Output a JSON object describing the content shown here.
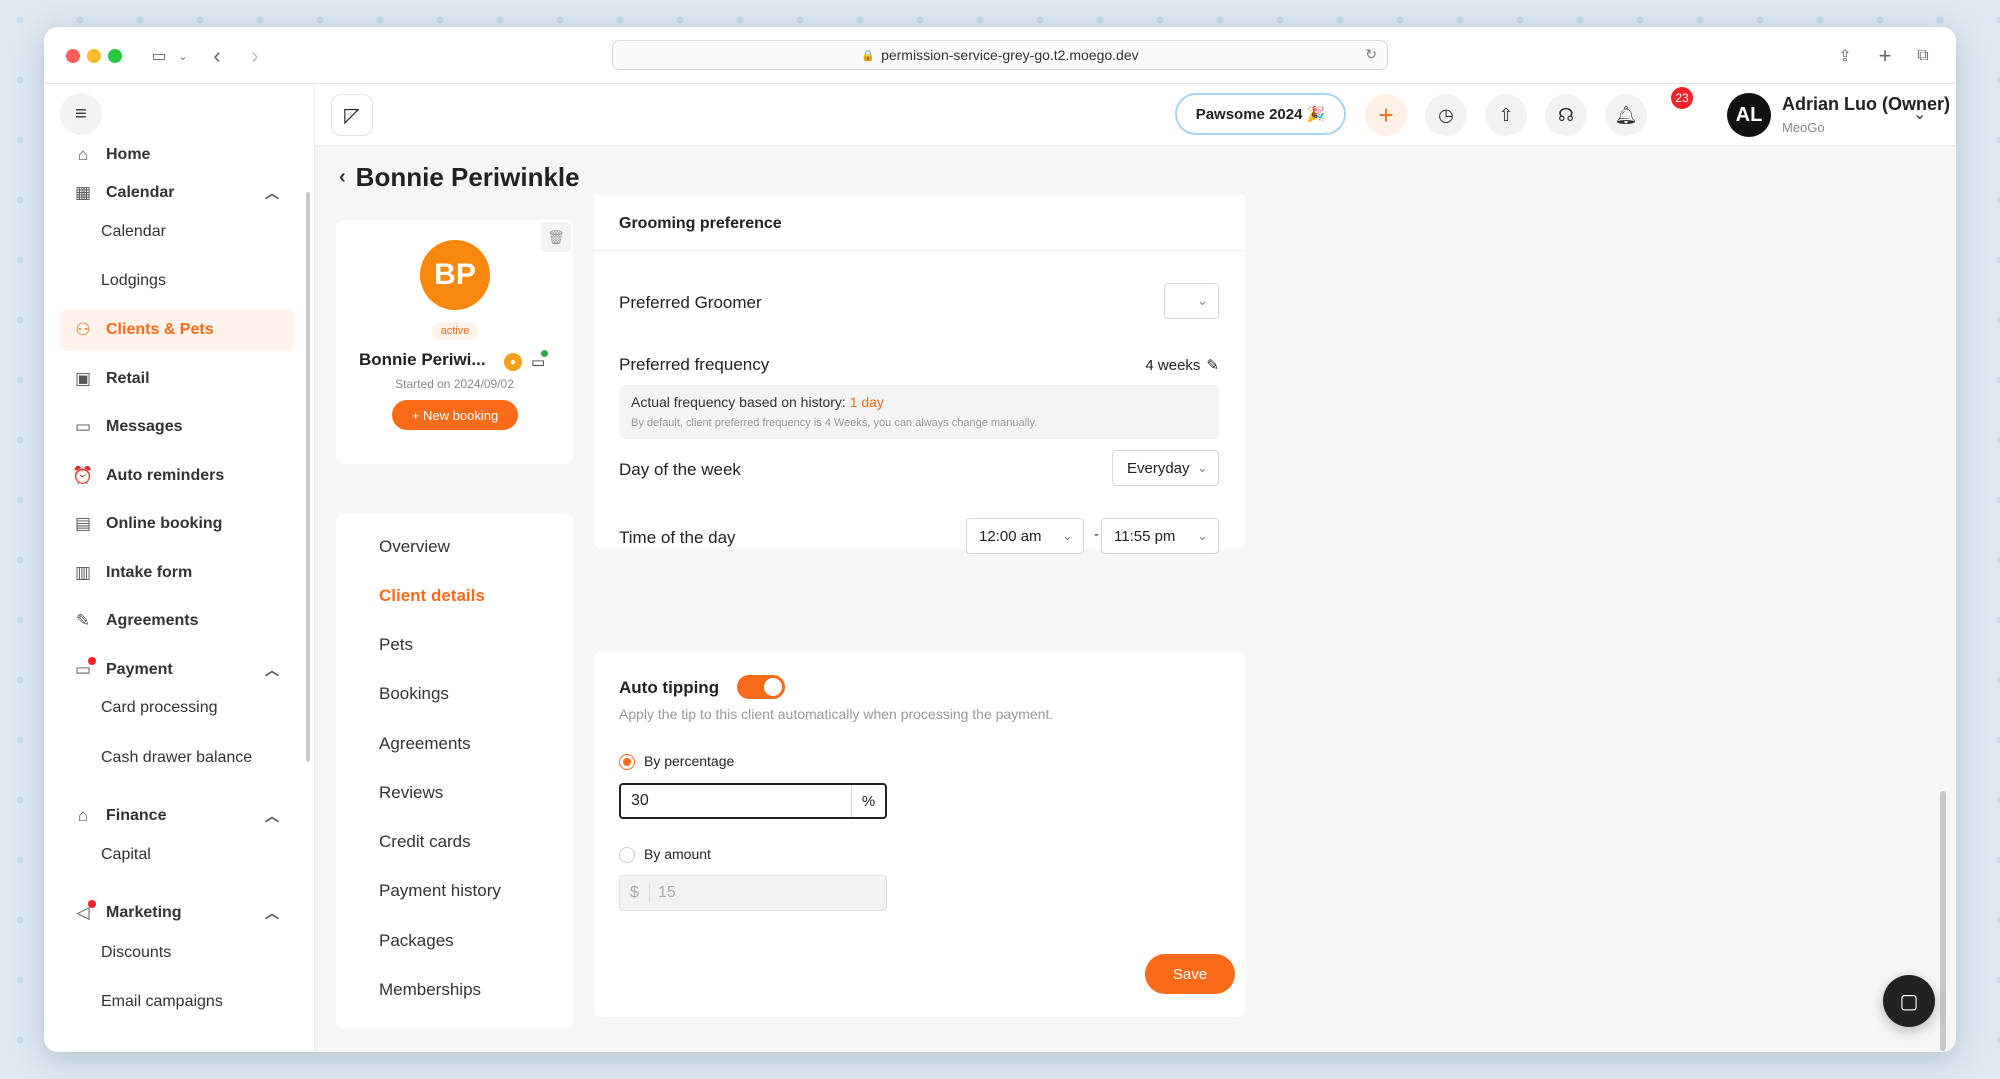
{
  "browser": {
    "url": "permission-service-grey-go.t2.moego.dev"
  },
  "sidebar": {
    "items": [
      {
        "label": "Home",
        "icon": "home-icon"
      },
      {
        "label": "Calendar",
        "icon": "calendar-icon"
      },
      {
        "label": "Clients & Pets",
        "icon": "clients-icon",
        "active": true
      },
      {
        "label": "Retail",
        "icon": "retail-icon"
      },
      {
        "label": "Messages",
        "icon": "messages-icon"
      },
      {
        "label": "Auto reminders",
        "icon": "alarm-icon"
      },
      {
        "label": "Online booking",
        "icon": "online-booking-icon"
      },
      {
        "label": "Intake form",
        "icon": "form-icon"
      },
      {
        "label": "Agreements",
        "icon": "pen-icon"
      },
      {
        "label": "Payment",
        "icon": "payment-icon"
      },
      {
        "label": "Finance",
        "icon": "bank-icon"
      },
      {
        "label": "Marketing",
        "icon": "megaphone-icon"
      }
    ],
    "sub": {
      "calendar": "Calendar",
      "lodgings": "Lodgings",
      "card_processing": "Card processing",
      "cash_drawer": "Cash drawer balance",
      "capital": "Capital",
      "discounts": "Discounts",
      "email_campaigns": "Email campaigns"
    }
  },
  "header": {
    "pawsome": "Pawsome 2024 🎉",
    "notification_count": "23",
    "user_initials": "AL",
    "user_name": "Adrian Luo (Owner)",
    "company": "MeoGo"
  },
  "page": {
    "title": "Bonnie Periwinkle"
  },
  "profile": {
    "initials": "BP",
    "status": "active",
    "name": "Bonnie Periwi...",
    "started": "Started on 2024/09/02",
    "new_booking": "+ New booking"
  },
  "client_menu": [
    "Overview",
    "Client details",
    "Pets",
    "Bookings",
    "Agreements",
    "Reviews",
    "Credit cards",
    "Payment history",
    "Packages",
    "Memberships"
  ],
  "grooming": {
    "section_title": "Grooming preference",
    "preferred_groomer_label": "Preferred Groomer",
    "preferred_frequency_label": "Preferred frequency",
    "preferred_frequency_value": "4 weeks",
    "actual_frequency_text": "Actual frequency based on history: ",
    "actual_frequency_value": "1 day",
    "frequency_note": "By default, client preferred frequency is 4 Weeks, you can always change manually.",
    "day_label": "Day of the week",
    "day_value": "Everyday",
    "time_label": "Time of the day",
    "time_start": "12:00 am",
    "time_end": "11:55 pm",
    "time_sep": "-"
  },
  "tipping": {
    "title": "Auto tipping",
    "enabled": true,
    "description": "Apply the tip to this client automatically when processing the payment.",
    "by_percentage_label": "By percentage",
    "percentage_value": "30",
    "percent_suffix": "%",
    "by_amount_label": "By amount",
    "amount_prefix": "$",
    "amount_value": "15",
    "save_label": "Save"
  },
  "colors": {
    "accent": "#f96b18",
    "badge": "#f5222d"
  }
}
